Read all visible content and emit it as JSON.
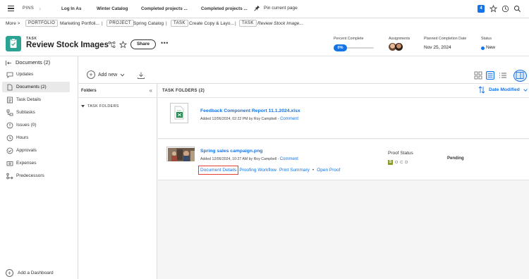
{
  "topbar": {
    "pins_label": "PINS",
    "pins": [
      "Log In As",
      "Winter Catalog",
      "Completed projects ...",
      "Completed projects ..."
    ],
    "pin_current_label": "Pin current page",
    "notification_count": "4"
  },
  "breadcrumb": {
    "more": "More >",
    "portfolio_tag": "PORTFOLIO",
    "portfolio_name": "Marketing Portfoli...",
    "project_tag": "PROJECT",
    "project_name": "Spring Catalog",
    "task_tag": "TASK",
    "task_name": "Create Copy & Layo...",
    "task_tag_2": "TASK",
    "current": "Review Stock Image...",
    "separator": "|"
  },
  "header": {
    "kind": "TASK",
    "title": "Review Stock Images",
    "share_label": "Share",
    "more_label": "•••",
    "percent_label": "Percent Complete",
    "percent_value": "0%",
    "percent_fraction": 0,
    "assignments_label": "Assignments",
    "planned_label": "Planned Completion Date",
    "planned_value": "Nov 25, 2024",
    "status_label": "Status",
    "status_value": "New",
    "status_color": "#1473e6"
  },
  "sidebar": {
    "title": "Documents (2)",
    "items": [
      {
        "label": "Updates",
        "icon": "updates-icon"
      },
      {
        "label": "Documents (2)",
        "icon": "document-icon"
      },
      {
        "label": "Task Details",
        "icon": "details-icon"
      },
      {
        "label": "Subtasks",
        "icon": "subtasks-icon"
      },
      {
        "label": "Issues (0)",
        "icon": "issues-icon"
      },
      {
        "label": "Hours",
        "icon": "clock-icon"
      },
      {
        "label": "Approvals",
        "icon": "approvals-icon"
      },
      {
        "label": "Expenses",
        "icon": "expenses-icon"
      },
      {
        "label": "Predecessors",
        "icon": "predecessors-icon"
      }
    ],
    "add_dashboard": "Add a Dashboard"
  },
  "toolbar": {
    "add_new": "Add new"
  },
  "folders": {
    "header": "Folders",
    "task_folders": "TASK FOLDERS"
  },
  "documents": {
    "header": "TASK FOLDERS (2)",
    "sort_label": "Date Modified",
    "accent": "#1473e6",
    "items": [
      {
        "name": "Feedback Component Report 11.1.2024.xlsx",
        "meta": "Added 12/06/2024, 02:22 PM by Roy Campbell -",
        "comment": "Comment"
      },
      {
        "name": "Spring sales campaign.png",
        "meta": "Added 12/06/2024, 10:27 AM by Roy Campbell -",
        "comment": "Comment",
        "actions": [
          "Document Details",
          "Proofing Workflow",
          "Print Summary",
          "Open Proof"
        ],
        "action_sep": "•",
        "proof_status_label": "Proof Status",
        "proof_letters": [
          "S",
          "O",
          "C",
          "D"
        ],
        "proof_state": "Pending"
      }
    ]
  }
}
